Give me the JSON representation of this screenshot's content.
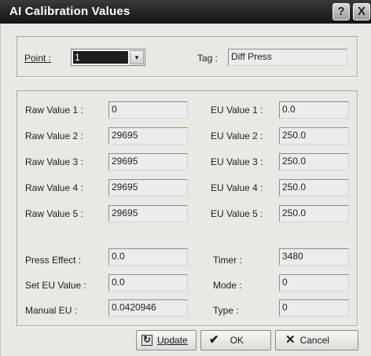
{
  "window": {
    "title": "AI Calibration Values",
    "help_icon": "?",
    "close_icon": "X"
  },
  "point": {
    "label": "Point :",
    "value": "1",
    "dropdown_glyph": "▾"
  },
  "tag": {
    "label": "Tag :",
    "value": "Diff Press"
  },
  "raw_values": [
    {
      "label": "Raw Value 1 :",
      "value": "0"
    },
    {
      "label": "Raw Value 2 :",
      "value": "29695"
    },
    {
      "label": "Raw Value 3 :",
      "value": "29695"
    },
    {
      "label": "Raw Value 4 :",
      "value": "29695"
    },
    {
      "label": "Raw Value 5 :",
      "value": "29695"
    }
  ],
  "eu_values": [
    {
      "label": "EU Value 1 :",
      "value": "0.0"
    },
    {
      "label": "EU Value 2 :",
      "value": "250.0"
    },
    {
      "label": "EU Value 3 :",
      "value": "250.0"
    },
    {
      "label": "EU Value 4 :",
      "value": "250.0"
    },
    {
      "label": "EU Value 5 :",
      "value": "250.0"
    }
  ],
  "settings_left": [
    {
      "label": "Press Effect :",
      "value": "0.0"
    },
    {
      "label": "Set EU Value :",
      "value": "0.0"
    },
    {
      "label": "Manual EU :",
      "value": "0.0420946"
    }
  ],
  "settings_right": [
    {
      "label": "Timer :",
      "value": "3480"
    },
    {
      "label": "Mode :",
      "value": "0"
    },
    {
      "label": "Type :",
      "value": "0"
    }
  ],
  "buttons": {
    "update": {
      "label": "Update",
      "icon": "update-icon"
    },
    "ok": {
      "label": "OK",
      "icon": "check-icon"
    },
    "cancel": {
      "label": "Cancel",
      "icon": "x-icon"
    }
  }
}
